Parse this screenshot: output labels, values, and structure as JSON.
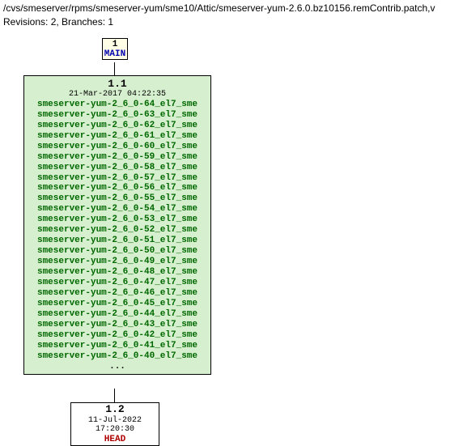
{
  "header": {
    "path": "/cvs/smeserver/rpms/smeserver-yum/sme10/Attic/smeserver-yum-2.6.0.bz10156.remContrib.patch,v",
    "revisions": "Revisions: 2, Branches: 1"
  },
  "node1": {
    "num": "1",
    "label": "MAIN"
  },
  "main": {
    "version": "1.1",
    "date": "21-Mar-2017 04:22:35",
    "tags": [
      "smeserver-yum-2_6_0-64_el7_sme",
      "smeserver-yum-2_6_0-63_el7_sme",
      "smeserver-yum-2_6_0-62_el7_sme",
      "smeserver-yum-2_6_0-61_el7_sme",
      "smeserver-yum-2_6_0-60_el7_sme",
      "smeserver-yum-2_6_0-59_el7_sme",
      "smeserver-yum-2_6_0-58_el7_sme",
      "smeserver-yum-2_6_0-57_el7_sme",
      "smeserver-yum-2_6_0-56_el7_sme",
      "smeserver-yum-2_6_0-55_el7_sme",
      "smeserver-yum-2_6_0-54_el7_sme",
      "smeserver-yum-2_6_0-53_el7_sme",
      "smeserver-yum-2_6_0-52_el7_sme",
      "smeserver-yum-2_6_0-51_el7_sme",
      "smeserver-yum-2_6_0-50_el7_sme",
      "smeserver-yum-2_6_0-49_el7_sme",
      "smeserver-yum-2_6_0-48_el7_sme",
      "smeserver-yum-2_6_0-47_el7_sme",
      "smeserver-yum-2_6_0-46_el7_sme",
      "smeserver-yum-2_6_0-45_el7_sme",
      "smeserver-yum-2_6_0-44_el7_sme",
      "smeserver-yum-2_6_0-43_el7_sme",
      "smeserver-yum-2_6_0-42_el7_sme",
      "smeserver-yum-2_6_0-41_el7_sme",
      "smeserver-yum-2_6_0-40_el7_sme"
    ],
    "dots": "..."
  },
  "node12": {
    "version": "1.2",
    "date": "11-Jul-2022 17:20:30",
    "head": "HEAD"
  }
}
